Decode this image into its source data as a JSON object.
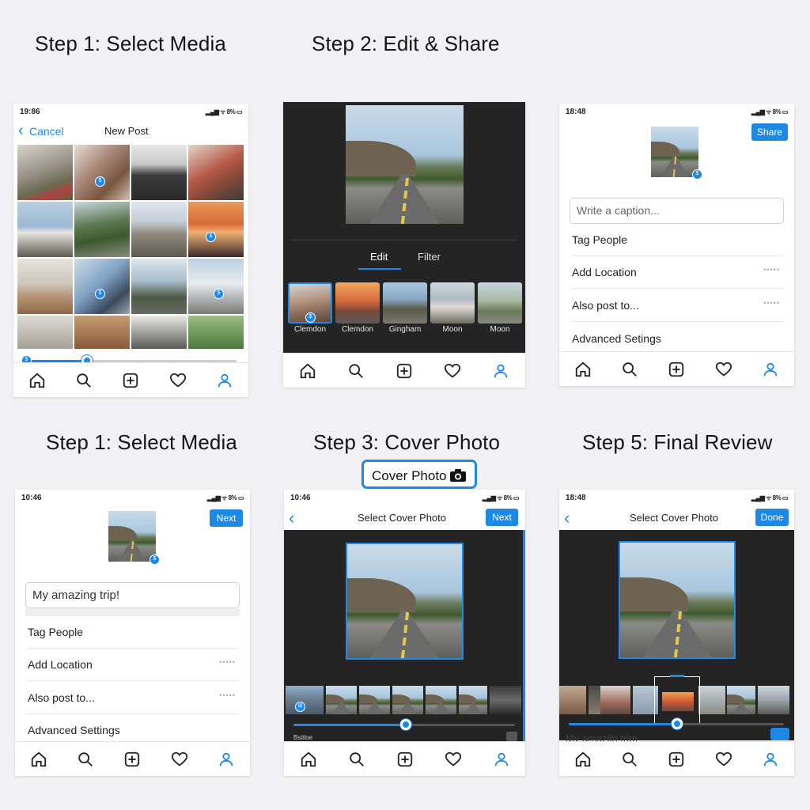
{
  "titles": {
    "t1": "Step 1: Select Media",
    "t2": "Step 2: Edit & Share",
    "t4": "Step 1: Select Media",
    "t5": "Step 3: Cover Photo",
    "t6": "Step 5: Final Review",
    "cover_badge": "Cover Photo"
  },
  "p1": {
    "time": "19:86",
    "status_icons": "▂▄▆ ᯤ 8% ▭",
    "cancel": "Cancel",
    "title": "New Post",
    "slider_value": 0.3
  },
  "p2": {
    "tab_edit": "Edit",
    "tab_filter": "Filter",
    "filters": [
      "Clemdon",
      "Clemdon",
      "Gingham",
      "Moon",
      "Moon"
    ]
  },
  "p3": {
    "time": "18:48",
    "status_icons": "▂▄▆ ᯤ 8% ▭",
    "share": "Share",
    "caption_placeholder": "Write a caption...",
    "rows": [
      "Tag People",
      "Add Location",
      "Also post to...",
      "Advanced Setings"
    ],
    "dots": "•••••"
  },
  "p4": {
    "time": "10:46",
    "status_icons": "▂▄▆ ᯤ 8% ▭",
    "next": "Next",
    "caption_value": "My amazing trip!",
    "rows": [
      "Tag People",
      "Add Location",
      "Also post to...",
      "Advanced Settings"
    ],
    "dots": "•••••"
  },
  "p5": {
    "time": "10:46",
    "status_icons": "▂▄▆ ᯤ 8% ▭",
    "title": "Select Cover Photo",
    "next": "Next",
    "bottom_text": "Bsitloe"
  },
  "p6": {
    "time": "18:48",
    "status_icons": "▂▄▆ ᯤ 8% ▭",
    "title": "Select Cover Photo",
    "done": "Done",
    "caption_peek": "My amaziin trim"
  },
  "colors": {
    "accent": "#1e88e5",
    "dark_bg": "#242424"
  }
}
